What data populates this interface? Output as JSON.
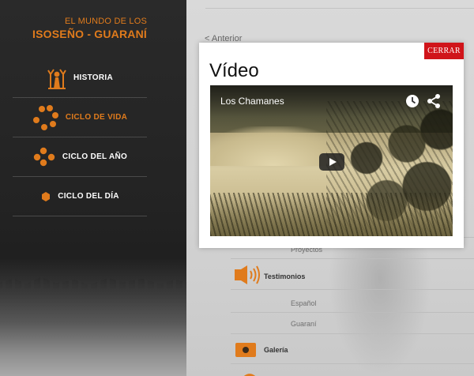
{
  "brand": {
    "line1": "EL MUNDO DE LOS",
    "line2": "ISOSEÑO - GUARANÍ",
    "accent_color": "#e07b1c"
  },
  "menu": {
    "items": [
      {
        "label": "HISTORIA",
        "icon": "baobab-tree-icon",
        "active": false
      },
      {
        "label": "CICLO DE VIDA",
        "icon": "dots-ring-icon",
        "active": true
      },
      {
        "label": "CICLO DEL AÑO",
        "icon": "dots-cluster-icon",
        "active": false
      },
      {
        "label": "CICLO DEL DÍA",
        "icon": "single-dot-icon",
        "active": false
      }
    ]
  },
  "content": {
    "back_label": "Anterior",
    "subnav": {
      "proyectos": "Proyectos",
      "testimonios": "Testimonios",
      "espanol": "Español",
      "guarani": "Guaraní",
      "galeria": "Galería"
    }
  },
  "modal": {
    "close_label": "CERRAR",
    "close_color": "#d0141a",
    "title": "Vídeo",
    "player": {
      "video_title": "Los Chamanes",
      "icons": [
        "clock-icon",
        "share-icon",
        "play-icon"
      ]
    }
  }
}
